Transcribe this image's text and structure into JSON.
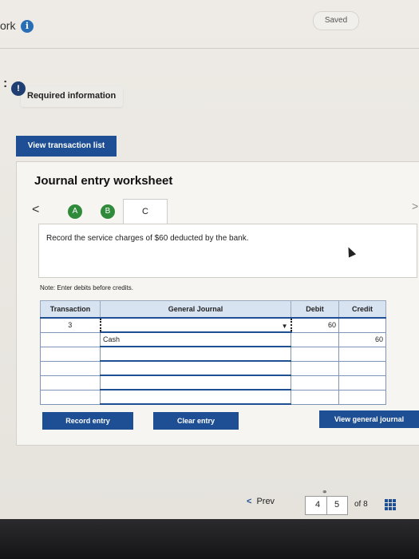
{
  "header": {
    "partial_title": "ork",
    "saved_label": "Saved",
    "info_icon": "info-icon"
  },
  "alert": {
    "colon": ":",
    "icon_glyph": "!",
    "label": "Required information"
  },
  "view_transaction_list": "View transaction list",
  "worksheet": {
    "title": "Journal entry worksheet",
    "prev_chevron": "<",
    "next_chevron": ">",
    "tabs": [
      {
        "label": "A",
        "state": "completed"
      },
      {
        "label": "B",
        "state": "completed"
      },
      {
        "label": "C",
        "state": "active"
      }
    ],
    "description": "Record the service charges of $60 deducted by the bank.",
    "note": "Note: Enter debits before credits."
  },
  "journal_table": {
    "headers": [
      "Transaction",
      "General Journal",
      "Debit",
      "Credit"
    ],
    "rows": [
      {
        "transaction": "3",
        "account": "",
        "debit": "60",
        "credit": ""
      },
      {
        "transaction": "",
        "account": "Cash",
        "debit": "",
        "credit": "60"
      },
      {
        "transaction": "",
        "account": "",
        "debit": "",
        "credit": ""
      },
      {
        "transaction": "",
        "account": "",
        "debit": "",
        "credit": ""
      },
      {
        "transaction": "",
        "account": "",
        "debit": "",
        "credit": ""
      },
      {
        "transaction": "",
        "account": "",
        "debit": "",
        "credit": ""
      }
    ]
  },
  "buttons": {
    "record": "Record entry",
    "clear": "Clear entry",
    "view_general": "View general journal"
  },
  "pager": {
    "prev_label": "Prev",
    "prev_chevron": "<",
    "current": "4",
    "next": "5",
    "of_label": "of 8"
  },
  "colors": {
    "primary_button": "#1e4f94",
    "tab_completed": "#2f8a3a",
    "info": "#2a6fb6"
  }
}
